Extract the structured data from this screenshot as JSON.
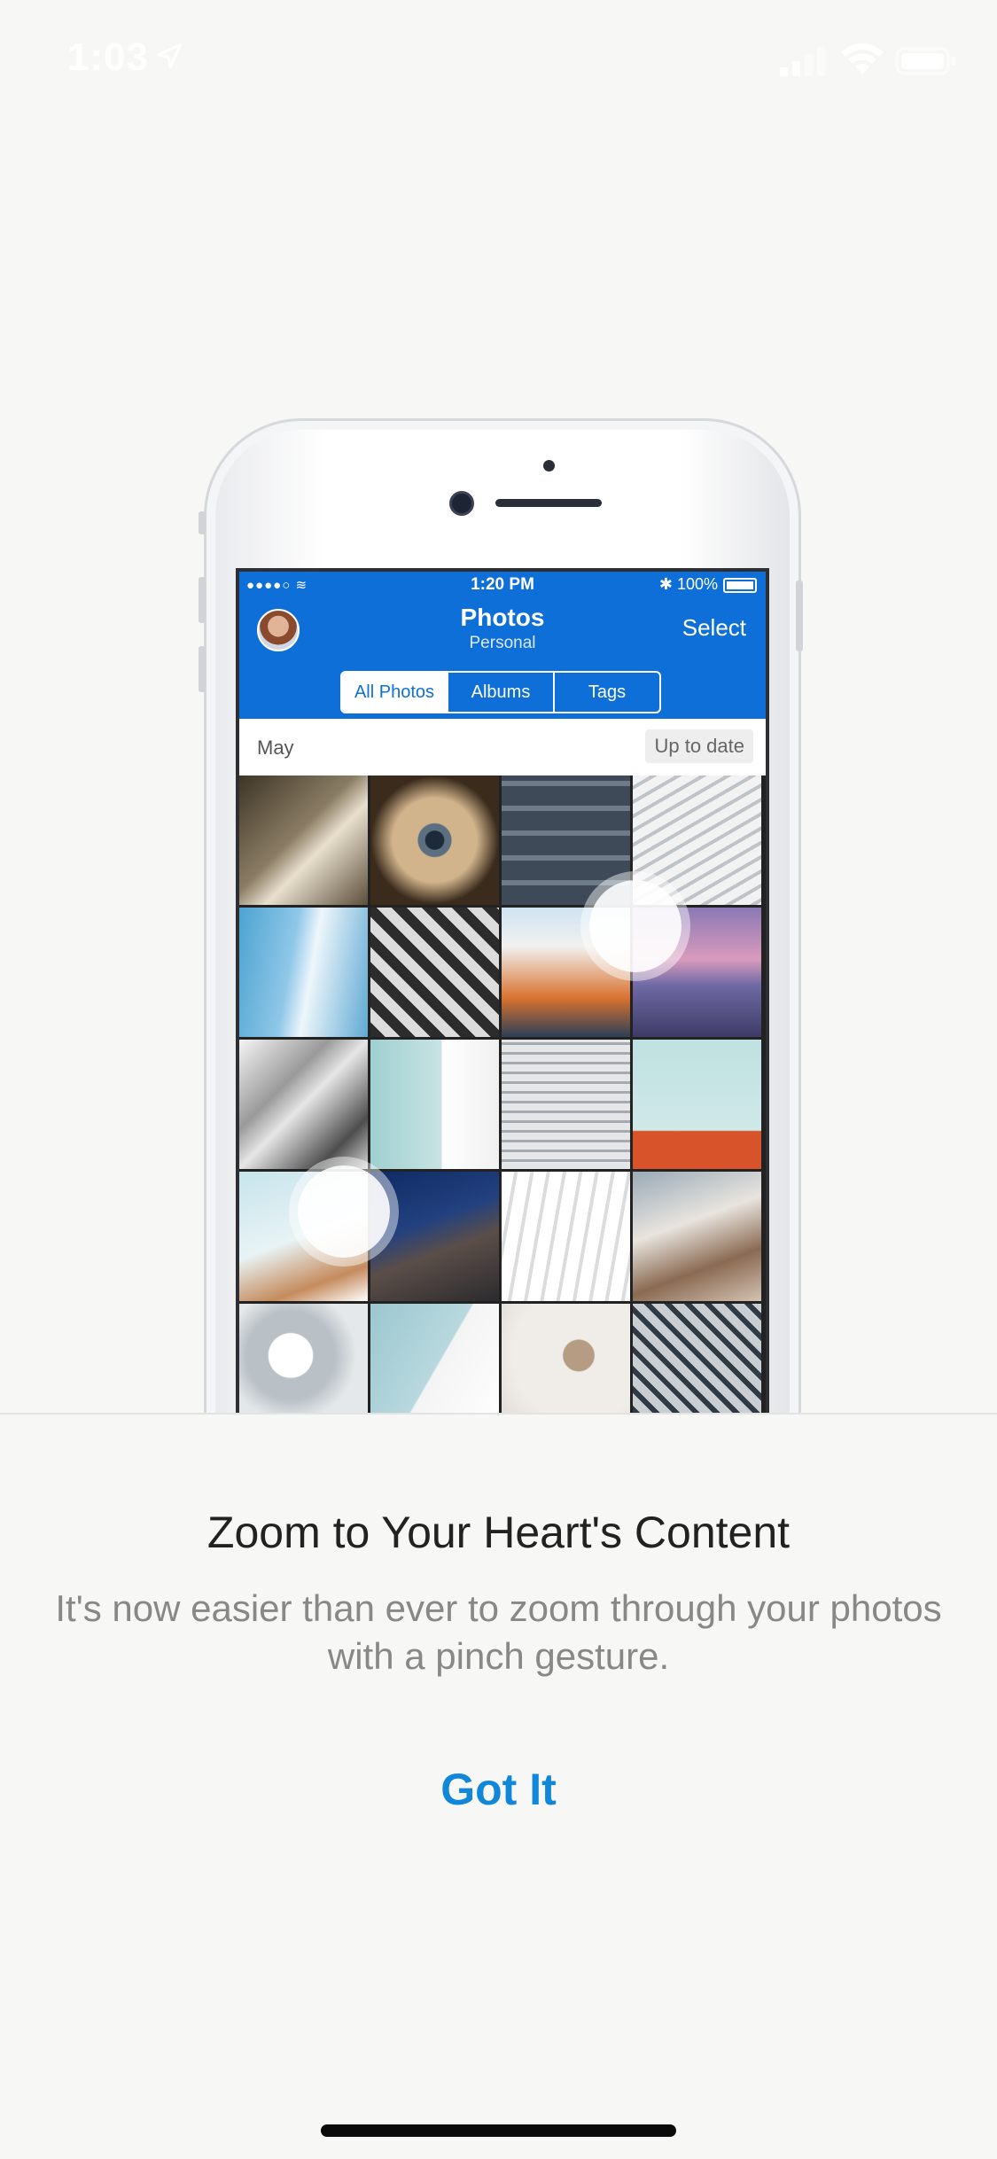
{
  "status_bar": {
    "time": "1:03",
    "icons": [
      "location-arrow-icon",
      "signal-icon",
      "wifi-icon",
      "battery-icon"
    ]
  },
  "illustration": {
    "inner_status": {
      "time": "1:20 PM",
      "battery": "100%"
    },
    "header": {
      "title": "Photos",
      "subtitle": "Personal",
      "select_label": "Select"
    },
    "segments": [
      "All Photos",
      "Albums",
      "Tags"
    ],
    "active_segment": "All Photos",
    "section": {
      "month": "May",
      "status": "Up to date"
    }
  },
  "onboarding": {
    "title": "Zoom to Your Heart's Content",
    "description": "It's now easier than ever to zoom through your photos with a pinch gesture.",
    "button_label": "Got It"
  },
  "colors": {
    "accent": "#1187d9",
    "header_blue": "#0e6fd9"
  }
}
